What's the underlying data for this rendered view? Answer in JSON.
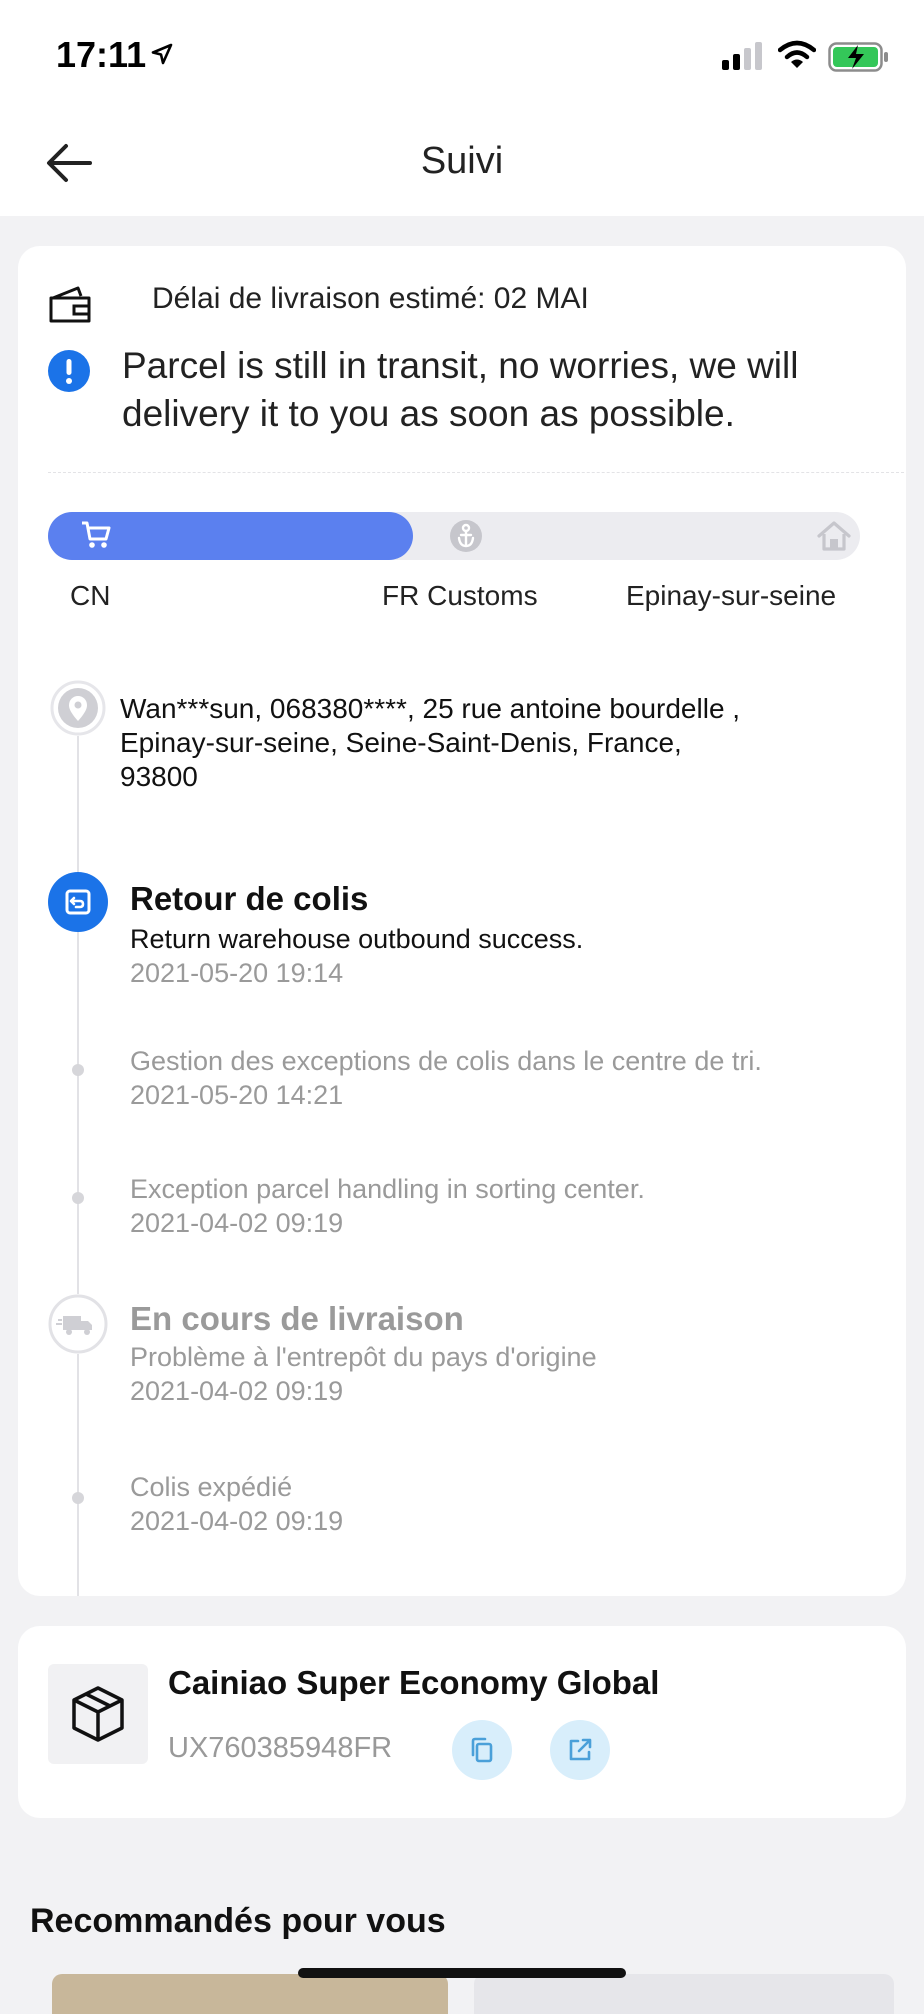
{
  "status_bar": {
    "time": "17:11"
  },
  "header": {
    "title": "Suivi"
  },
  "estimate": {
    "text": "Délai de livraison estimé: 02 MAI"
  },
  "notice": {
    "text": "Parcel is still in transit, no worries, we will delivery it to you as soon as possible."
  },
  "progress": {
    "stages": [
      "CN",
      "FR Customs",
      "Epinay-sur-seine"
    ],
    "completed_fraction": 0.45
  },
  "address": {
    "text": "Wan***sun,  068380****,  25 rue antoine bourdelle ,  Epinay-sur-seine,  Seine-Saint-Denis,  France,  93800"
  },
  "events": [
    {
      "title": "Retour de colis",
      "detail": "Return warehouse outbound success.",
      "time": "2021-05-20 19:14"
    },
    {
      "detail": "Gestion des exceptions de colis dans le centre de tri.",
      "time": "2021-05-20 14:21"
    },
    {
      "detail": "Exception parcel handling in sorting center.",
      "time": "2021-04-02 09:19"
    },
    {
      "title": "En cours de livraison",
      "detail": "Problème à l'entrepôt du pays d'origine",
      "time": "2021-04-02 09:19"
    },
    {
      "detail": "Colis expédié",
      "time": "2021-04-02 09:19"
    }
  ],
  "carrier": {
    "name": "Cainiao Super Economy Global",
    "tracking_number": "UX760385948FR"
  },
  "recommendations": {
    "title": "Recommandés pour vous"
  },
  "colors": {
    "accent": "#5b80ef",
    "active_event": "#1b73e8",
    "action_bg": "#d8eefb"
  },
  "icons": [
    "location-arrow-icon",
    "signal-icon",
    "wifi-icon",
    "battery-charging-icon",
    "back-arrow-icon",
    "wallet-icon",
    "info-icon",
    "cart-icon",
    "anchor-icon",
    "house-icon",
    "map-pin-icon",
    "return-icon",
    "truck-icon",
    "package-icon",
    "copy-icon",
    "external-link-icon"
  ]
}
